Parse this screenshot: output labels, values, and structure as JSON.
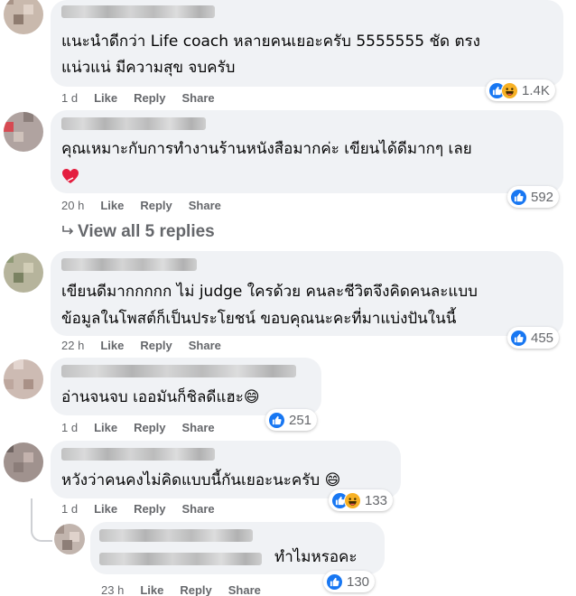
{
  "comments": [
    {
      "text_line1": "แนะนำดีกว่า Life coach หลายคนเยอะครับ 5555555 ชัด ตรง",
      "text_line2": "แน่วแน่ มีความสุข จบครับ",
      "time": "1 d",
      "like": "Like",
      "reply": "Reply",
      "share": "Share",
      "reactions": [
        "like-icon",
        "haha-icon"
      ],
      "count": "1.4K"
    },
    {
      "text_line1": "คุณเหมาะกับการทำงานร้านหนังสือมากค่ะ เขียนได้ดีมากๆ เลย",
      "time": "20 h",
      "like": "Like",
      "reply": "Reply",
      "share": "Share",
      "reactions": [
        "like-icon"
      ],
      "count": "592",
      "view_replies": "View all 5 replies"
    },
    {
      "text_line1": "เขียนดีมากกกกก ไม่ judge ใครด้วย คนละชีวิตจึงคิดคนละแบบ",
      "text_line2": "ข้อมูลในโพสต์ก็เป็นประโยชน์ ขอบคุณนะคะที่มาแบ่งปันในนี้",
      "time": "22 h",
      "like": "Like",
      "reply": "Reply",
      "share": "Share",
      "reactions": [
        "like-icon"
      ],
      "count": "455"
    },
    {
      "text_line1": "อ่านจนจบ เออมันก็ชิลดีแฮะ😄",
      "time": "1 d",
      "like": "Like",
      "reply": "Reply",
      "share": "Share",
      "reactions": [
        "like-icon"
      ],
      "count": "251"
    },
    {
      "text_line1": "หวังว่าคนคงไม่คิดแบบนี้กันเยอะนะครับ 😄",
      "time": "1 d",
      "like": "Like",
      "reply": "Reply",
      "share": "Share",
      "reactions": [
        "like-icon",
        "haha-icon"
      ],
      "count": "133"
    },
    {
      "text_line1": "ทำไมหรอคะ",
      "time": "23 h",
      "like": "Like",
      "reply": "Reply",
      "share": "Share",
      "reactions": [
        "like-icon"
      ],
      "count": "130"
    }
  ],
  "colors": {
    "like_blue": "#1877f2",
    "haha_yellow": "#f7b125",
    "bubble_gray": "#f0f2f5",
    "meta_gray": "#65676b",
    "heart_red": "#e41e3f"
  }
}
